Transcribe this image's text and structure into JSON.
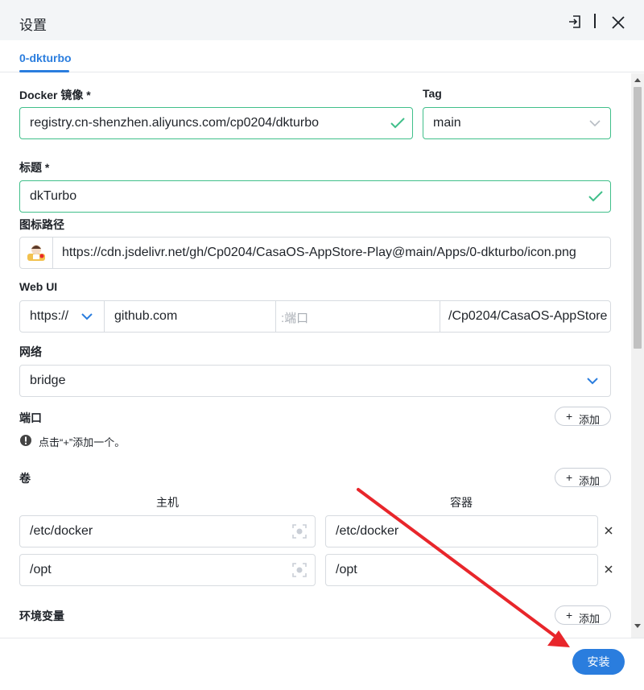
{
  "dialog": {
    "title": "设置"
  },
  "tabs": [
    {
      "label": "0-dkturbo"
    }
  ],
  "docker_image": {
    "label": "Docker 镜像 *",
    "value": "registry.cn-shenzhen.aliyuncs.com/cp0204/dkturbo"
  },
  "tag": {
    "label": "Tag",
    "value": "main"
  },
  "title_field": {
    "label": "标题 *",
    "value": "dkTurbo"
  },
  "icon_path": {
    "label": "图标路径",
    "value": "https://cdn.jsdelivr.net/gh/Cp0204/CasaOS-AppStore-Play@main/Apps/0-dkturbo/icon.png"
  },
  "webui": {
    "label": "Web UI",
    "scheme": "https://",
    "host": "github.com",
    "port_placeholder": ":端口",
    "path": "/Cp0204/CasaOS-AppStore"
  },
  "network": {
    "label": "网络",
    "value": "bridge"
  },
  "ports": {
    "label": "端口",
    "add_label": "添加",
    "hint": "点击“+”添加一个。"
  },
  "volumes": {
    "label": "卷",
    "add_label": "添加",
    "host_header": "主机",
    "container_header": "容器",
    "rows": [
      {
        "host": "/etc/docker",
        "container": "/etc/docker"
      },
      {
        "host": "/opt",
        "container": "/opt"
      }
    ]
  },
  "env": {
    "label": "环境变量",
    "add_label": "添加"
  },
  "footer": {
    "install_label": "安装"
  },
  "colors": {
    "accent": "#2a7dde",
    "valid": "#40bf8a",
    "annotation": "#e8262b"
  }
}
